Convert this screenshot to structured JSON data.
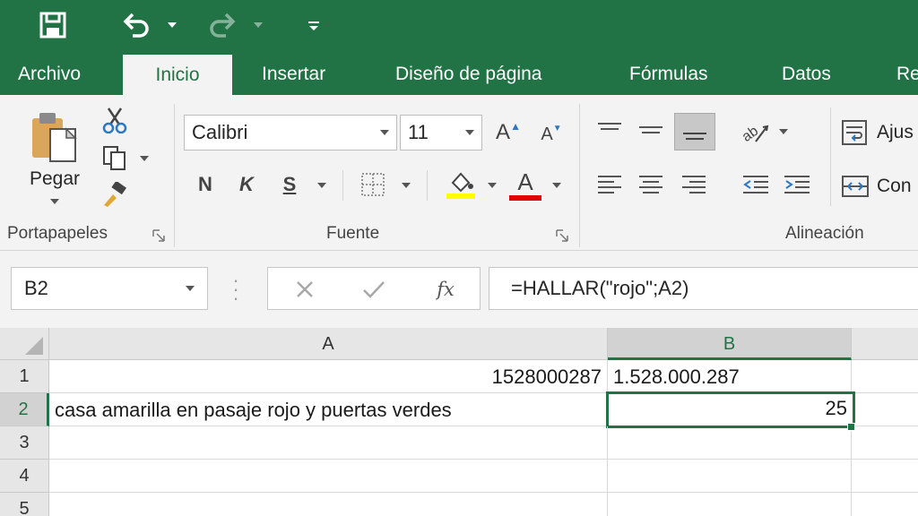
{
  "quick_access": {
    "save_icon": "save-icon",
    "undo_icon": "undo-icon",
    "redo_icon": "redo-icon",
    "customize_icon": "customize-qat-icon"
  },
  "tabs": [
    {
      "label": "Archivo"
    },
    {
      "label": "Inicio"
    },
    {
      "label": "Insertar"
    },
    {
      "label": "Diseño de página"
    },
    {
      "label": "Fórmulas"
    },
    {
      "label": "Datos"
    },
    {
      "label": "Re"
    }
  ],
  "ribbon": {
    "clipboard": {
      "paste_label": "Pegar",
      "group_label": "Portapapeles"
    },
    "font": {
      "font_name": "Calibri",
      "font_size": "11",
      "bold_label": "N",
      "italic_label": "K",
      "underline_label": "S",
      "group_label": "Fuente",
      "highlight_color": "#ffff00",
      "font_color": "#e00000"
    },
    "alignment": {
      "wrap_label": "Ajus",
      "merge_label": "Con",
      "group_label": "Alineación"
    }
  },
  "formula_bar": {
    "name_box": "B2",
    "fx_label": "fx",
    "formula": "=HALLAR(\"rojo\";A2)"
  },
  "sheet": {
    "columns": [
      "A",
      "B"
    ],
    "rows": [
      "1",
      "2",
      "3",
      "4",
      "5"
    ],
    "cells": {
      "A1": "1528000287",
      "B1": "1.528.000.287",
      "A2": "casa amarilla en pasaje rojo y puertas verdes",
      "B2": "25"
    },
    "selected_cell": "B2",
    "accent_color": "#217346"
  }
}
